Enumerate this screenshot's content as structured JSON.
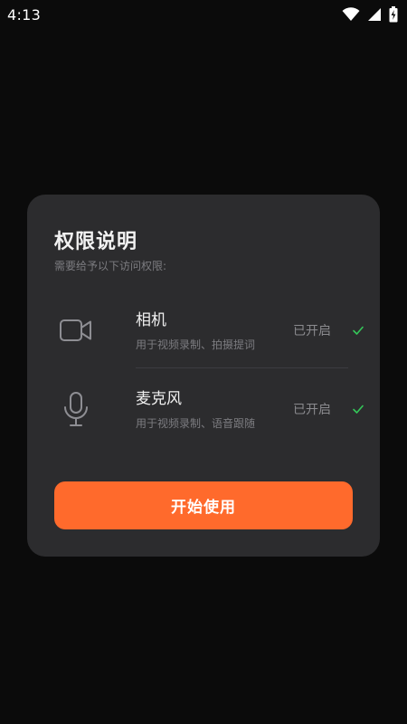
{
  "status_bar": {
    "time": "4:13",
    "icons": [
      "wifi-icon",
      "cellular-signal-icon",
      "battery-charging-icon"
    ]
  },
  "dialog": {
    "title": "权限说明",
    "subtitle": "需要给予以下访问权限:",
    "permissions": [
      {
        "icon": "video-camera-icon",
        "name": "相机",
        "description": "用于视频录制、拍摄提词",
        "status": "已开启",
        "granted": true
      },
      {
        "icon": "microphone-icon",
        "name": "麦克风",
        "description": "用于视频录制、语音跟随",
        "status": "已开启",
        "granted": true
      }
    ],
    "button_label": "开始使用"
  },
  "colors": {
    "background": "#0b0b0b",
    "card": "#2c2c2e",
    "accent": "#ff6a2c",
    "check": "#34c759",
    "muted_text": "#7c7c80"
  }
}
